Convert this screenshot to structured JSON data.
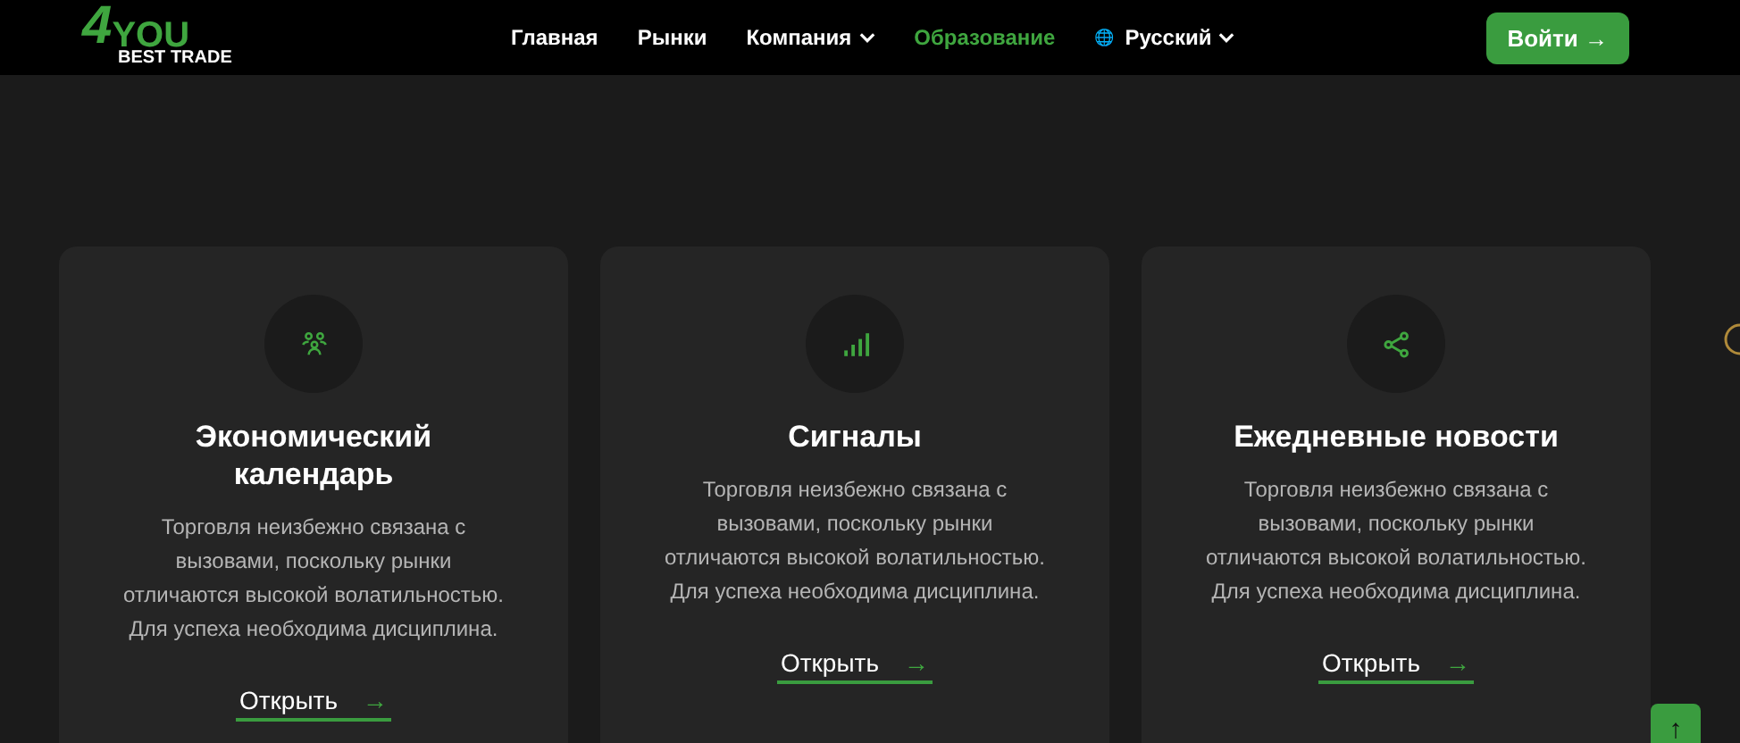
{
  "logo": {
    "mark": "4",
    "word": "YOU",
    "tagline": "BEST TRADE"
  },
  "nav": [
    {
      "label": "Главная",
      "selected": false,
      "dropdown": false
    },
    {
      "label": "Рынки",
      "selected": false,
      "dropdown": false
    },
    {
      "label": "Компания",
      "selected": false,
      "dropdown": true
    },
    {
      "label": "Образование",
      "selected": true,
      "dropdown": false
    }
  ],
  "language": {
    "icon": "🌐",
    "label": "Русский"
  },
  "login": {
    "label": "Войти",
    "arrow": "→"
  },
  "cards": [
    {
      "kind": "people",
      "title": "Экономический календарь",
      "text": "Торговля неизбежно связана с вызовами, поскольку рынки отличаются высокой волатильностью. Для успеха необходима дисциплина.",
      "link": "Открыть",
      "arrow": "→"
    },
    {
      "kind": "signal",
      "title": "Сигналы",
      "text": "Торговля неизбежно связана с вызовами, поскольку рынки отличаются высокой волатильностью. Для успеха необходима дисциплина.",
      "link": "Открыть",
      "arrow": "→"
    },
    {
      "kind": "share",
      "title": "Ежедневные новости",
      "text": "Торговля неизбежно связана с вызовами, поскольку рынки отличаются высокой волатильностью. Для успеха необходима дисциплина.",
      "link": "Открыть",
      "arrow": "→"
    }
  ],
  "scroll_top": {
    "label": "↑"
  }
}
